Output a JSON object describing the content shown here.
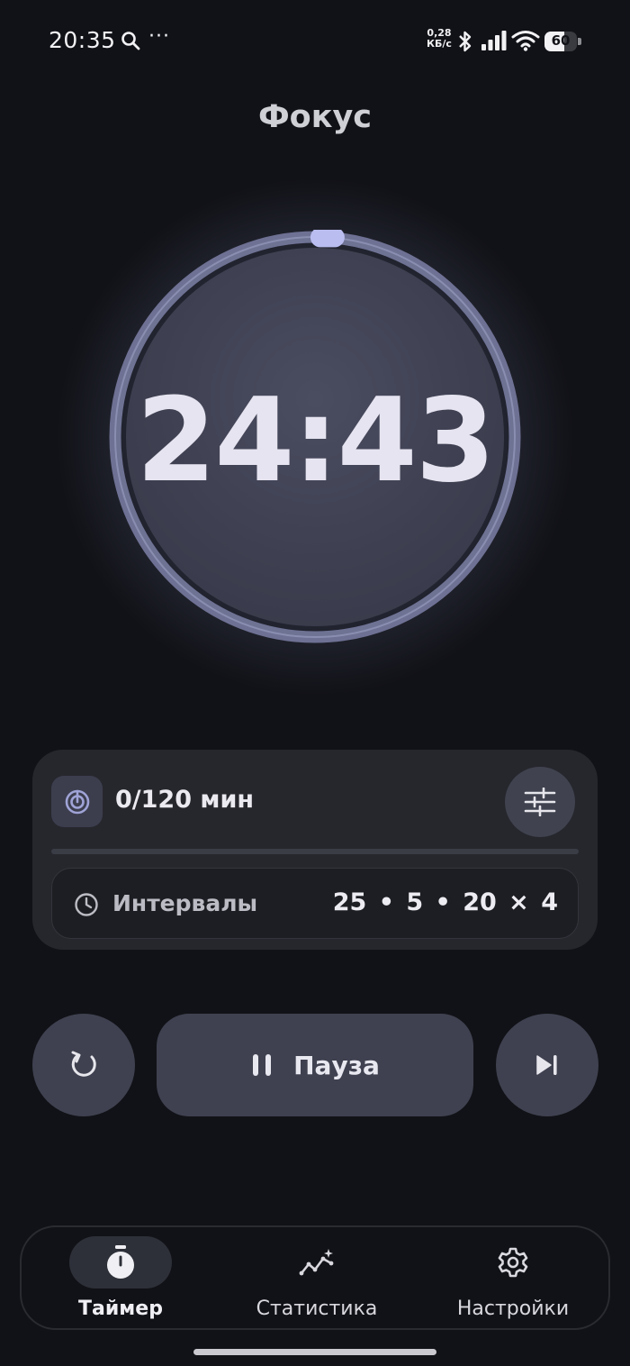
{
  "status_bar": {
    "time": "20:35",
    "dots": "···",
    "net_speed_value": "0,28",
    "net_speed_unit": "КБ/с",
    "battery": "60",
    "battery_level": 0.6,
    "icons": [
      "search-icon",
      "bluetooth-icon",
      "signal-icon",
      "wifi-icon",
      "battery-icon"
    ]
  },
  "header": {
    "title": "Фокус"
  },
  "timer": {
    "time": "24:43",
    "ring_progress": 0.01,
    "colors": {
      "ring": "#7c80a6",
      "knob": "#b9bdf0",
      "face": "#3d3f50"
    }
  },
  "goal": {
    "text": "0/120 мин",
    "progress": 0.0,
    "intervals_label": "Интервалы",
    "intervals_value": "25 • 5 • 20 × 4"
  },
  "controls": {
    "pause_label": "Пауза",
    "icons": [
      "reset-icon",
      "pause-icon",
      "skip-next-icon"
    ]
  },
  "nav": {
    "items": [
      {
        "label": "Таймер",
        "icon": "stopwatch-icon",
        "active": true
      },
      {
        "label": "Статистика",
        "icon": "stats-icon",
        "active": false
      },
      {
        "label": "Настройки",
        "icon": "gear-icon",
        "active": false
      }
    ]
  },
  "colors": {
    "background": "#111217",
    "card": "#26272d",
    "button": "#3f4150",
    "accent": "#8f93b8"
  }
}
